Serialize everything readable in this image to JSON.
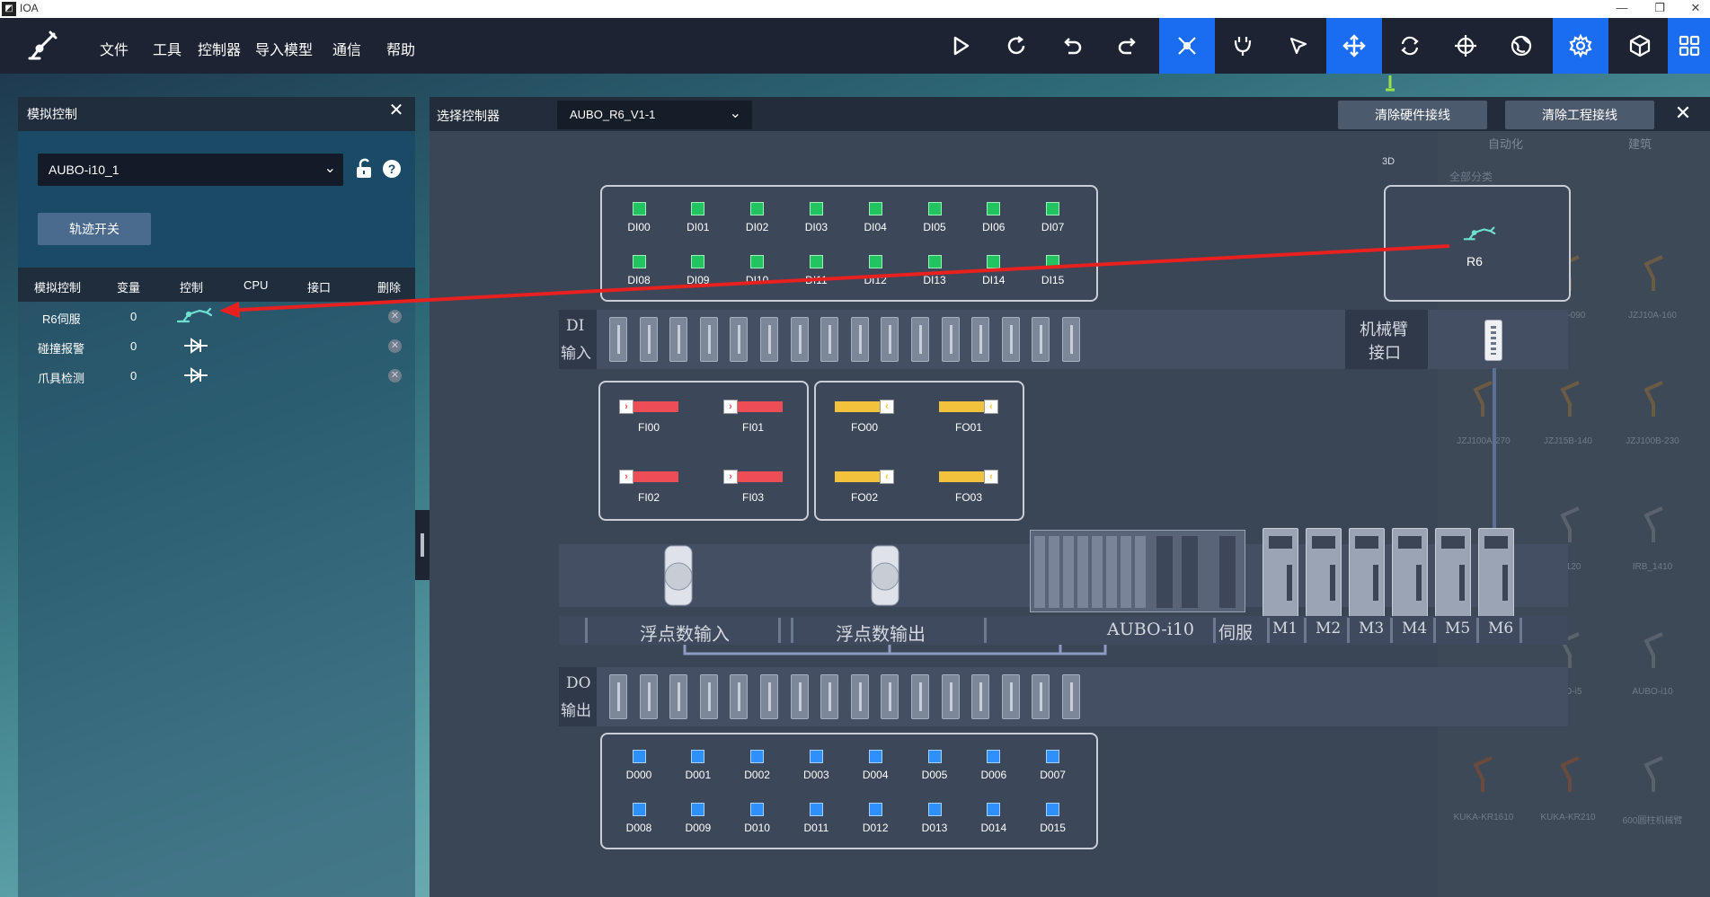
{
  "window": {
    "title": "IOA",
    "app_icon": "app-icon"
  },
  "menu": {
    "items": [
      "文件",
      "工具",
      "控制器",
      "导入模型",
      "通信",
      "帮助"
    ]
  },
  "toolbar": {
    "icons": [
      "play-icon",
      "refresh-icon",
      "undo-icon",
      "redo-icon",
      "robot-arm-icon",
      "gripper-icon",
      "cursor-icon",
      "move-icon",
      "rotate-icon",
      "target-icon",
      "globe-icon",
      "settings-icon",
      "cube-icon",
      "grid-icon"
    ],
    "active": [
      "robot-arm-icon",
      "move-icon",
      "settings-icon",
      "grid-icon"
    ],
    "accent": "#1a6cf0"
  },
  "left_panel": {
    "title": "模拟控制",
    "controller_select": "AUBO-i10_1",
    "trajectory_button": "轨迹开关",
    "columns": [
      "模拟控制",
      "变量",
      "控制",
      "CPU",
      "接口",
      "删除"
    ],
    "rows": [
      {
        "name": "R6伺服",
        "value": "0",
        "control_icon": "robot-arm-icon"
      },
      {
        "name": "碰撞报警",
        "value": "0",
        "control_icon": "diode-icon"
      },
      {
        "name": "爪具检测",
        "value": "0",
        "control_icon": "diode-icon"
      }
    ]
  },
  "main_panel": {
    "title": "选择控制器",
    "controller_select": "AUBO_R6_V1-1",
    "clear_hardware_button": "清除硬件接线",
    "clear_project_button": "清除工程接线"
  },
  "di": {
    "labels": [
      "DI00",
      "DI01",
      "DI02",
      "DI03",
      "DI04",
      "DI05",
      "DI06",
      "DI07",
      "DI08",
      "DI09",
      "DI10",
      "DI11",
      "DI12",
      "DI13",
      "DI14",
      "DI15"
    ],
    "color": "#22c462",
    "strip_label": [
      "DI",
      "输入"
    ]
  },
  "robot_box": {
    "label": "R6",
    "port_label": [
      "机械臂",
      "接口"
    ]
  },
  "fi": {
    "labels": [
      "FI00",
      "FI01",
      "FI02",
      "FI03"
    ],
    "color": "#ef4d55"
  },
  "fo": {
    "labels": [
      "FO00",
      "FO01",
      "FO02",
      "FO03"
    ],
    "color": "#f3c23d"
  },
  "bus_labels": {
    "float_in": "浮点数输入",
    "float_out": "浮点数输出",
    "controller": "AUBO-i10",
    "servo": "伺服",
    "motors": [
      "M1",
      "M2",
      "M3",
      "M4",
      "M5",
      "M6"
    ]
  },
  "do": {
    "labels": [
      "D000",
      "D001",
      "D002",
      "D003",
      "D004",
      "D005",
      "D006",
      "D007",
      "D008",
      "D009",
      "D010",
      "D011",
      "D012",
      "D013",
      "D014",
      "D015"
    ],
    "color": "#2e8fff",
    "strip_label": [
      "DO",
      "输出"
    ]
  },
  "gallery": {
    "tabs": [
      "自动化",
      "建筑"
    ],
    "filter": "全部分类",
    "view_label": "3D",
    "items": [
      "A-090",
      "JZJ10A-160",
      "JZJ100A-270",
      "JZJ15B-140",
      "JZJ100B-230",
      "120",
      "IRB_1410",
      "O-i5",
      "AUBO-i10",
      "KUKA-KR1610",
      "KUKA-KR210",
      "600圆柱机械臂"
    ]
  }
}
